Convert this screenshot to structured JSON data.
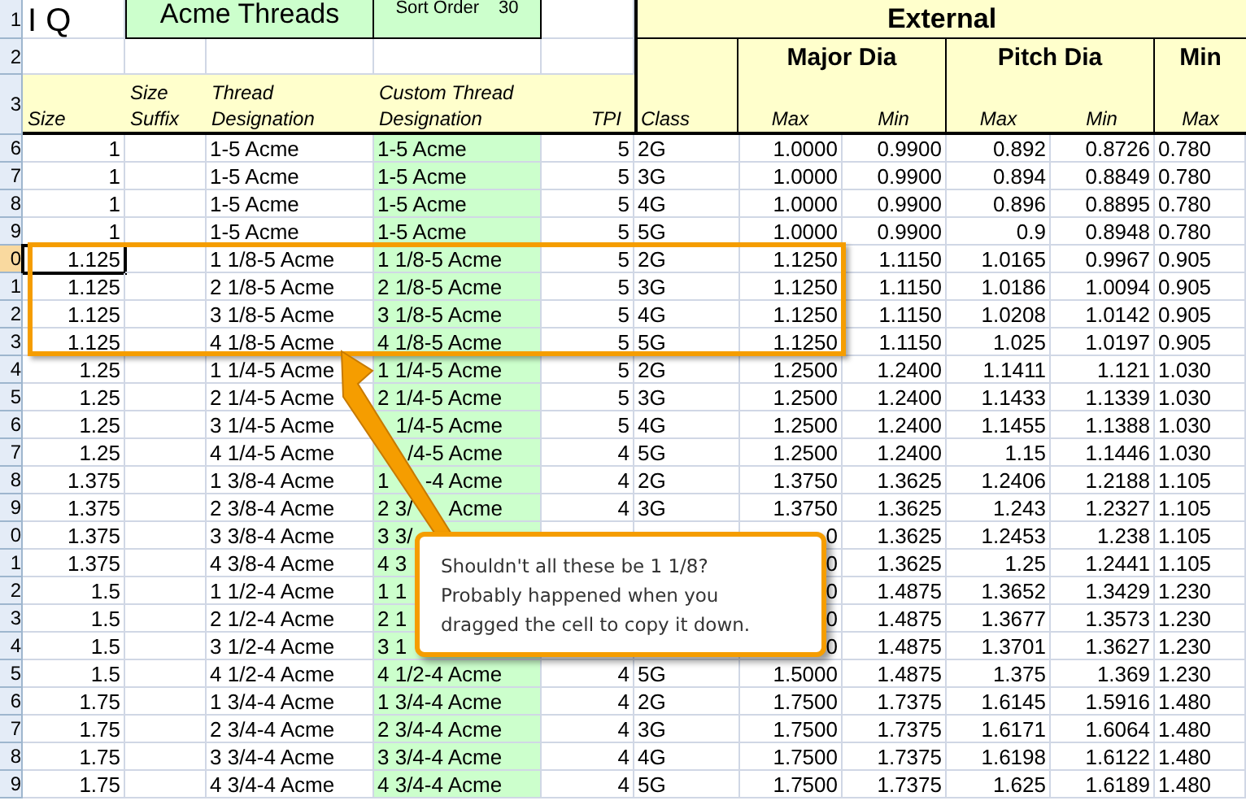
{
  "row_numbers_header": [
    "1",
    "2",
    "3"
  ],
  "logo": "I Q",
  "title": "Acme Threads",
  "sort_label": "Sort Order",
  "sort_value": "30",
  "group_header": "External",
  "class_header": "Class",
  "subgroups": [
    {
      "title": "Major Dia",
      "labels": [
        "Max",
        "Min"
      ]
    },
    {
      "title": "Pitch Dia",
      "labels": [
        "Max",
        "Min"
      ]
    },
    {
      "title": "Min",
      "labels": [
        "Max"
      ]
    }
  ],
  "left_headers": [
    "Size",
    "Size Suffix",
    "Thread Designation",
    "Custom Thread Designation",
    "TPI"
  ],
  "rows": [
    {
      "num": "6",
      "selected": false,
      "size": "1",
      "thread": "1-5 Acme",
      "custom": "1-5 Acme",
      "tpi": "5",
      "class": "2G",
      "values": [
        "1.0000",
        "0.9900",
        "0.892",
        "0.8726",
        "0.780"
      ]
    },
    {
      "num": "7",
      "selected": false,
      "size": "1",
      "thread": "1-5 Acme",
      "custom": "1-5 Acme",
      "tpi": "5",
      "class": "3G",
      "values": [
        "1.0000",
        "0.9900",
        "0.894",
        "0.8849",
        "0.780"
      ]
    },
    {
      "num": "8",
      "selected": false,
      "size": "1",
      "thread": "1-5 Acme",
      "custom": "1-5 Acme",
      "tpi": "5",
      "class": "4G",
      "values": [
        "1.0000",
        "0.9900",
        "0.896",
        "0.8895",
        "0.780"
      ]
    },
    {
      "num": "9",
      "selected": false,
      "size": "1",
      "thread": "1-5 Acme",
      "custom": "1-5 Acme",
      "tpi": "5",
      "class": "5G",
      "values": [
        "1.0000",
        "0.9900",
        "0.9",
        "0.8948",
        "0.780"
      ]
    },
    {
      "num": "0",
      "selected": true,
      "size": "1.125",
      "thread": "1 1/8-5 Acme",
      "custom": "1 1/8-5 Acme",
      "tpi": "5",
      "class": "2G",
      "values": [
        "1.1250",
        "1.1150",
        "1.0165",
        "0.9967",
        "0.905"
      ]
    },
    {
      "num": "1",
      "selected": false,
      "size": "1.125",
      "thread": "2 1/8-5 Acme",
      "custom": "2 1/8-5 Acme",
      "tpi": "5",
      "class": "3G",
      "values": [
        "1.1250",
        "1.1150",
        "1.0186",
        "1.0094",
        "0.905"
      ]
    },
    {
      "num": "2",
      "selected": false,
      "size": "1.125",
      "thread": "3 1/8-5 Acme",
      "custom": "3 1/8-5 Acme",
      "tpi": "5",
      "class": "4G",
      "values": [
        "1.1250",
        "1.1150",
        "1.0208",
        "1.0142",
        "0.905"
      ]
    },
    {
      "num": "3",
      "selected": false,
      "size": "1.125",
      "thread": "4 1/8-5 Acme",
      "custom": "4 1/8-5 Acme",
      "tpi": "5",
      "class": "5G",
      "values": [
        "1.1250",
        "1.1150",
        "1.025",
        "1.0197",
        "0.905"
      ]
    },
    {
      "num": "4",
      "selected": false,
      "size": "1.25",
      "thread": "1 1/4-5 Acme",
      "custom": "1 1/4-5 Acme",
      "tpi": "5",
      "class": "2G",
      "values": [
        "1.2500",
        "1.2400",
        "1.1411",
        "1.121",
        "1.030"
      ]
    },
    {
      "num": "5",
      "selected": false,
      "size": "1.25",
      "thread": "2 1/4-5 Acme",
      "custom": "2 1/4-5 Acme",
      "tpi": "5",
      "class": "3G",
      "values": [
        "1.2500",
        "1.2400",
        "1.1433",
        "1.1339",
        "1.030"
      ]
    },
    {
      "num": "6",
      "selected": false,
      "size": "1.25",
      "thread": "3 1/4-5 Acme",
      "custom": [
        {
          "kind": "end",
          "text": "1/4-5 Acme"
        }
      ],
      "tpi": "5",
      "class": "4G",
      "values": [
        "1.2500",
        "1.2400",
        "1.1455",
        "1.1388",
        "1.030"
      ]
    },
    {
      "num": "7",
      "selected": false,
      "size": "1.25",
      "thread": "4 1/4-5 Acme",
      "custom": [
        {
          "kind": "end",
          "text": "/4-5 Acme"
        }
      ],
      "tpi": "4",
      "class": "5G",
      "values": [
        "1.2500",
        "1.2400",
        "1.15",
        "1.1446",
        "1.030"
      ]
    },
    {
      "num": "8",
      "selected": false,
      "size": "1.375",
      "thread": "1 3/8-4 Acme",
      "custom": [
        {
          "kind": "start",
          "text": "1"
        },
        {
          "kind": "end",
          "text": "-4 Acme"
        }
      ],
      "tpi": "4",
      "class": "2G",
      "values": [
        "1.3750",
        "1.3625",
        "1.2406",
        "1.2188",
        "1.105"
      ]
    },
    {
      "num": "9",
      "selected": false,
      "size": "1.375",
      "thread": "2 3/8-4 Acme",
      "custom": [
        {
          "kind": "start",
          "text": "2 3/"
        },
        {
          "kind": "end",
          "text": "Acme"
        }
      ],
      "tpi": "4",
      "class": "3G",
      "values": [
        "1.3750",
        "1.3625",
        "1.243",
        "1.2327",
        "1.105"
      ]
    },
    {
      "num": "0",
      "selected": false,
      "size": "1.375",
      "thread": "3 3/8-4 Acme",
      "custom": "3 3/",
      "values": [
        "0",
        "1.3625",
        "1.2453",
        "1.238",
        "1.105"
      ]
    },
    {
      "num": "1",
      "selected": false,
      "size": "1.375",
      "thread": "4 3/8-4 Acme",
      "custom": "4 3",
      "values": [
        "0",
        "1.3625",
        "1.25",
        "1.2441",
        "1.105"
      ]
    },
    {
      "num": "2",
      "selected": false,
      "size": "1.5",
      "thread": "1 1/2-4 Acme",
      "custom": "1 1",
      "values": [
        "0",
        "1.4875",
        "1.3652",
        "1.3429",
        "1.230"
      ]
    },
    {
      "num": "3",
      "selected": false,
      "size": "1.5",
      "thread": "2 1/2-4 Acme",
      "custom": "2 1",
      "values": [
        "0",
        "1.4875",
        "1.3677",
        "1.3573",
        "1.230"
      ]
    },
    {
      "num": "4",
      "selected": false,
      "size": "1.5",
      "thread": "3 1/2-4 Acme",
      "custom": "3 1",
      "values": [
        "0",
        "1.4875",
        "1.3701",
        "1.3627",
        "1.230"
      ]
    },
    {
      "num": "5",
      "selected": false,
      "size": "1.5",
      "thread": "4 1/2-4 Acme",
      "custom": "4 1/2-4 Acme",
      "tpi": "4",
      "class": "5G",
      "values": [
        "1.5000",
        "1.4875",
        "1.375",
        "1.369",
        "1.230"
      ]
    },
    {
      "num": "6",
      "selected": false,
      "size": "1.75",
      "thread": "1 3/4-4 Acme",
      "custom": "1 3/4-4 Acme",
      "tpi": "4",
      "class": "2G",
      "values": [
        "1.7500",
        "1.7375",
        "1.6145",
        "1.5916",
        "1.480"
      ]
    },
    {
      "num": "7",
      "selected": false,
      "size": "1.75",
      "thread": "2 3/4-4 Acme",
      "custom": "2 3/4-4 Acme",
      "tpi": "4",
      "class": "3G",
      "values": [
        "1.7500",
        "1.7375",
        "1.6171",
        "1.6064",
        "1.480"
      ]
    },
    {
      "num": "8",
      "selected": false,
      "size": "1.75",
      "thread": "3 3/4-4 Acme",
      "custom": "3 3/4-4 Acme",
      "tpi": "4",
      "class": "4G",
      "values": [
        "1.7500",
        "1.7375",
        "1.6198",
        "1.6122",
        "1.480"
      ]
    },
    {
      "num": "9",
      "selected": false,
      "size": "1.75",
      "thread": "4 3/4-4 Acme",
      "custom": "4 3/4-4 Acme",
      "tpi": "4",
      "class": "5G",
      "values": [
        "1.7500",
        "1.7375",
        "1.625",
        "1.6189",
        "1.480"
      ]
    }
  ],
  "callout": {
    "lines": [
      "Shouldn't all these be 1 1/8?",
      "Probably happened when you",
      "dragged the cell to copy it down."
    ]
  }
}
